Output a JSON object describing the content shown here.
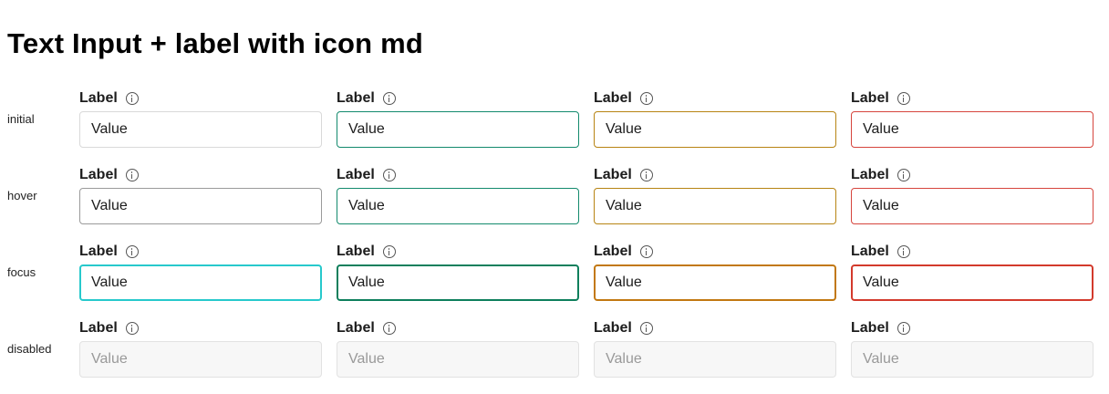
{
  "page": {
    "title": "Text Input + label with icon md"
  },
  "states": [
    "initial",
    "hover",
    "focus",
    "disabled"
  ],
  "variants": [
    "neutral",
    "success",
    "warning",
    "error"
  ],
  "field": {
    "label": "Label",
    "value": "Value",
    "icon": "info-icon"
  },
  "colors": {
    "neutral_border": "#d9d9d9",
    "hover_border": "#9a9a9a",
    "focus_border": "#27c9cc",
    "success": "#138a6d",
    "warning": "#b78413",
    "error": "#d6453d",
    "disabled_bg": "#f7f7f7"
  }
}
